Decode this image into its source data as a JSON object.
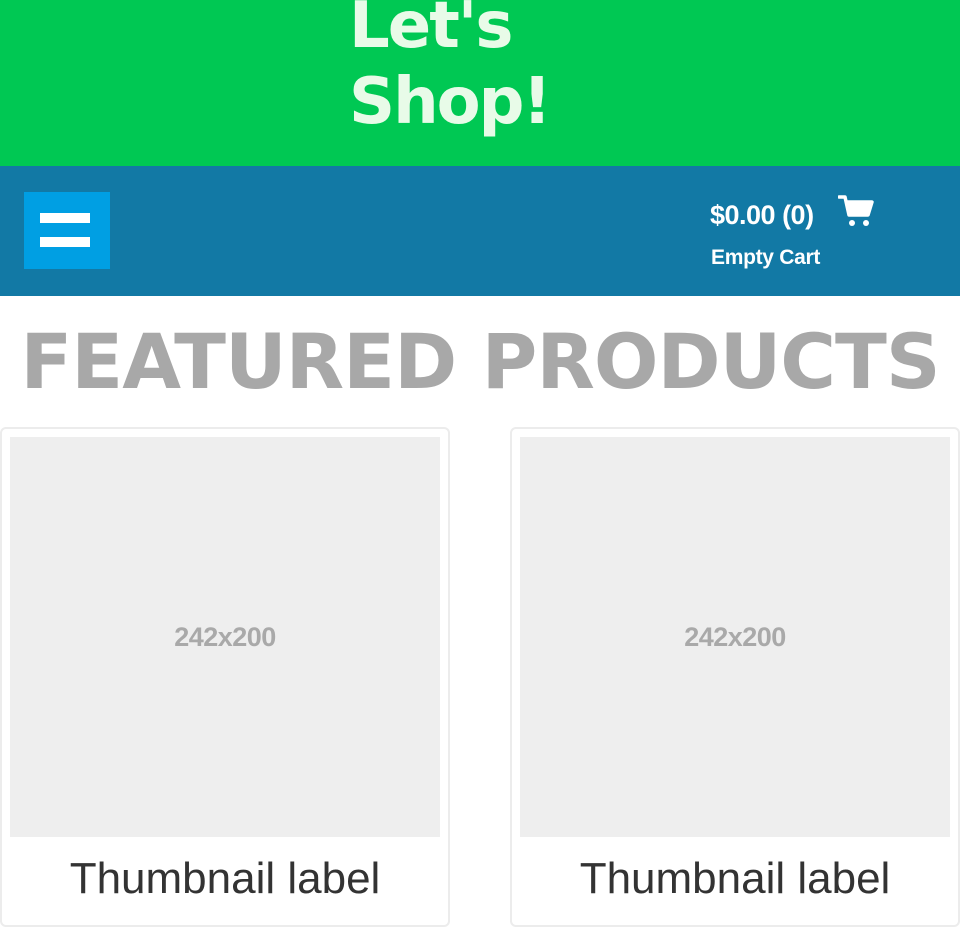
{
  "header": {
    "title": "Let's Shop!",
    "background_color": "#00c853"
  },
  "navbar": {
    "background_color": "#1279a5",
    "menu_icon": "hamburger-menu-icon",
    "menu_button_color": "#009fe3",
    "cart": {
      "total": "$0.00 (0)",
      "status": "Empty Cart",
      "icon": "shopping-cart-icon"
    }
  },
  "main": {
    "section_title": "FEATURED PRODUCTS",
    "products": [
      {
        "image_placeholder": "242x200",
        "label": "Thumbnail label"
      },
      {
        "image_placeholder": "242x200",
        "label": "Thumbnail label"
      }
    ]
  }
}
